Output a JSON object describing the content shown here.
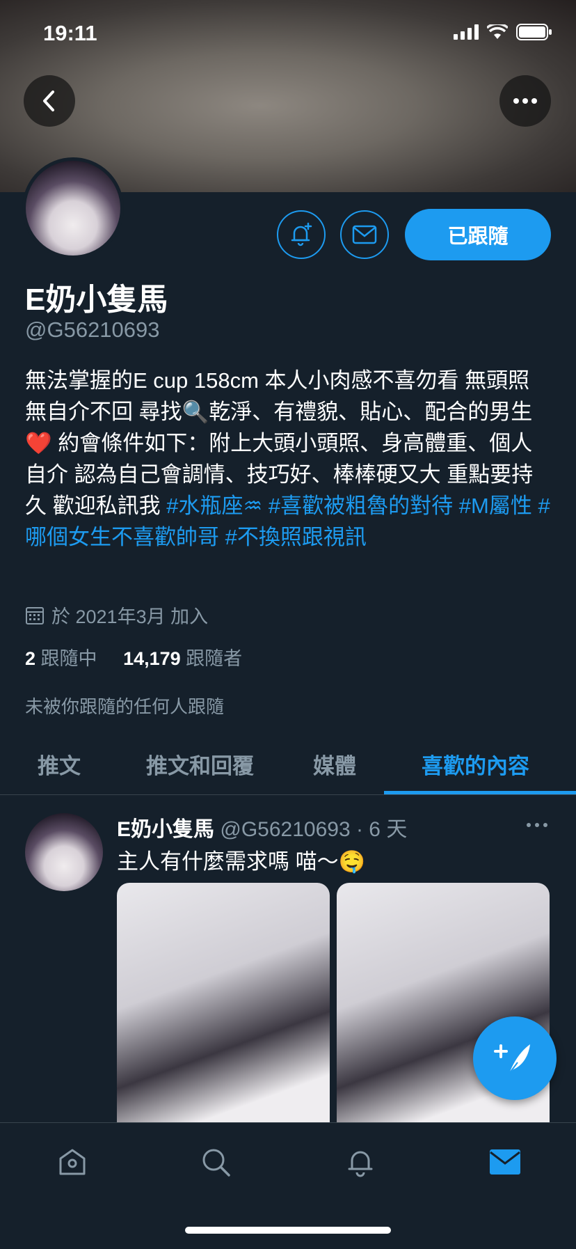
{
  "status_bar": {
    "time": "19:11"
  },
  "header": {
    "back_icon": "chevron-left-icon",
    "more_icon": "more-horizontal-icon"
  },
  "profile": {
    "name": "E奶小隻馬",
    "handle": "@G56210693",
    "follow_button_label": "已跟隨",
    "bio_text": "無法掌握的E cup 158cm 本人小肉感不喜勿看 無頭照無自介不回 尋找🔍乾淨、有禮貌、貼心、配合的男生❤️ 約會條件如下：附上大頭小頭照、身高體重、個人自介 認為自己會調情、技巧好、棒棒硬又大 重點要持久 歡迎私訊我 ",
    "bio_tags": [
      "#水瓶座♒",
      "#喜歡被粗魯的對待",
      "#M屬性",
      "#哪個女生不喜歡帥哥",
      "#不換照跟視訊"
    ],
    "joined": "於 2021年3月 加入",
    "following_count": "2",
    "following_label": "跟隨中",
    "followers_count": "14,179",
    "followers_label": "跟隨者",
    "not_followed_text": "未被你跟隨的任何人跟隨"
  },
  "tabs": [
    {
      "label": "推文"
    },
    {
      "label": "推文和回覆"
    },
    {
      "label": "媒體"
    },
    {
      "label": "喜歡的內容",
      "active": true
    }
  ],
  "tweet": {
    "author": "E奶小隻馬",
    "handle": "@G56210693",
    "time": "· 6 天",
    "text": "主人有什麼需求嗎 喵～🤤"
  },
  "bottom_nav": [
    {
      "icon": "home-icon"
    },
    {
      "icon": "search-icon"
    },
    {
      "icon": "bell-icon"
    },
    {
      "icon": "mail-icon",
      "active": true
    }
  ],
  "colors": {
    "background": "#15202b",
    "accent": "#1d9bf0",
    "secondary_text": "#8899a6"
  }
}
